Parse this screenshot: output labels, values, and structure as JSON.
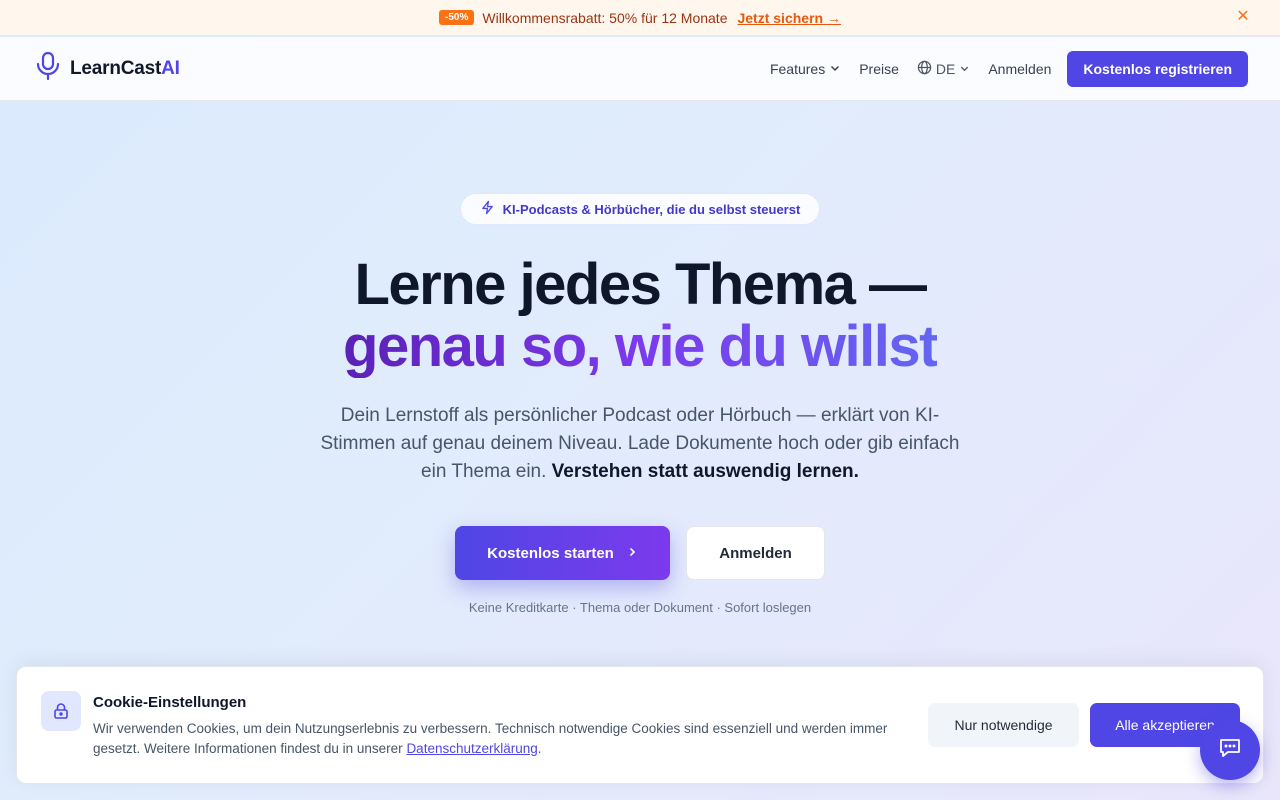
{
  "promo": {
    "badge": "-50%",
    "text": "Willkommensrabatt: 50% für 12 Monate",
    "link": "Jetzt sichern →",
    "close_icon": "close-icon",
    "close_glyph": "✕"
  },
  "nav": {
    "brand_prefix": "LearnCast",
    "brand_suffix": "AI",
    "logo_icon": "microphone-icon",
    "features": "Features",
    "pricing": "Preise",
    "language": "DE",
    "login": "Anmelden",
    "register": "Kostenlos registrieren"
  },
  "hero": {
    "pill": "KI-Podcasts & Hörbücher, die du selbst steuerst",
    "title_line1": "Lerne jedes Thema —",
    "title_line2": "genau so, wie du willst",
    "subtitle": "Dein Lernstoff als persönlicher Podcast oder Hörbuch — erklärt von KI-Stimmen auf genau deinem Niveau. Lade Dokumente hoch oder gib einfach ein Thema ein.",
    "subtitle_strong": "Verstehen statt auswendig lernen.",
    "cta_primary": "Kostenlos starten",
    "cta_secondary": "Anmelden",
    "note": "Keine Kreditkarte · Thema oder Dokument · Sofort loslegen"
  },
  "cookie": {
    "title": "Cookie-Einstellungen",
    "text": "Wir verwenden Cookies, um dein Nutzungserlebnis zu verbessern. Technisch notwendige Cookies sind essenziell und werden immer gesetzt. Weitere Informationen findest du in unserer",
    "link": "Datenschutzerklärung",
    "text_end": ".",
    "btn_necessary": "Nur notwendige",
    "btn_accept": "Alle akzeptieren"
  },
  "colors": {
    "primary": "#4f46e5",
    "accent_purple": "#7c3aed",
    "promo_orange": "#f97316"
  }
}
